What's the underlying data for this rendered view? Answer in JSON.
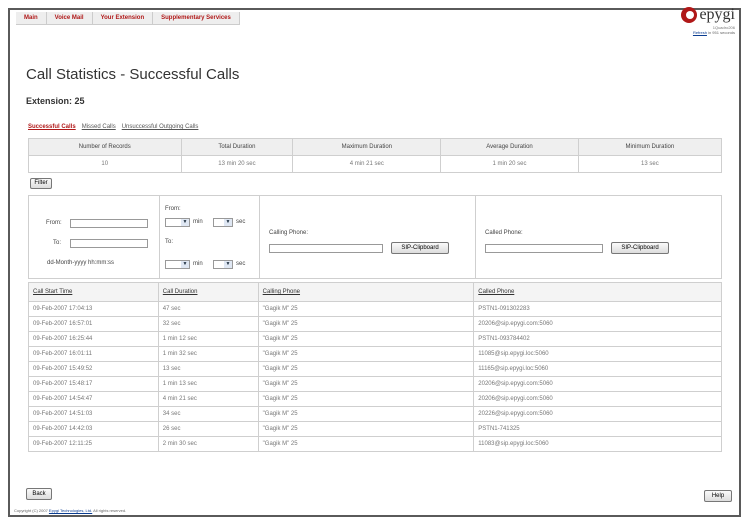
{
  "nav": {
    "items": [
      "Main",
      "Voice Mail",
      "Your Extension",
      "Supplementary Services"
    ]
  },
  "logo": {
    "brand": "epygi",
    "model": "1Quadro206",
    "refresh_link": "Refresh",
    "refresh_text": "in 951 seconds"
  },
  "page": {
    "title": "Call Statistics - Successful Calls",
    "extension": "Extension: 25"
  },
  "tabs": [
    {
      "label": "Successful Calls",
      "active": true
    },
    {
      "label": "Missed Calls",
      "active": false
    },
    {
      "label": "Unsuccessful Outgoing Calls",
      "active": false
    }
  ],
  "summary": {
    "headers": [
      "Number of Records",
      "Total Duration",
      "Maximum Duration",
      "Average Duration",
      "Minimum Duration"
    ],
    "values": [
      "10",
      "13 min 20 sec",
      "4 min 21 sec",
      "1 min 20 sec",
      "13 sec"
    ]
  },
  "filter": {
    "button": "Filter",
    "from_label": "From:",
    "to_label": "To:",
    "date_format": "dd-Month-yyyy hh:mm:ss",
    "duration_from": "From:",
    "duration_to": "To:",
    "min_label": "min",
    "sec_label": "sec",
    "calling_label": "Calling Phone:",
    "called_label": "Called Phone:",
    "sip_clipboard": "SIP-Clipboard"
  },
  "calls": {
    "headers": [
      "Call Start Time",
      "Call Duration",
      "Calling Phone",
      "Called Phone"
    ],
    "rows": [
      [
        "09-Feb-2007 17:04:13",
        "47 sec",
        "\"Gagik M\" 25",
        "PSTN1-091302283"
      ],
      [
        "09-Feb-2007 16:57:01",
        "32 sec",
        "\"Gagik M\" 25",
        "20206@sip.epygi.com:5060"
      ],
      [
        "09-Feb-2007 16:25:44",
        "1 min 12 sec",
        "\"Gagik M\" 25",
        "PSTN1-093784402"
      ],
      [
        "09-Feb-2007 16:01:11",
        "1 min 32 sec",
        "\"Gagik M\" 25",
        "11085@sip.epygi.loc:5060"
      ],
      [
        "09-Feb-2007 15:49:52",
        "13 sec",
        "\"Gagik M\" 25",
        "11165@sip.epygi.loc:5060"
      ],
      [
        "09-Feb-2007 15:48:17",
        "1 min 13 sec",
        "\"Gagik M\" 25",
        "20206@sip.epygi.com:5060"
      ],
      [
        "09-Feb-2007 14:54:47",
        "4 min 21 sec",
        "\"Gagik M\" 25",
        "20206@sip.epygi.com:5060"
      ],
      [
        "09-Feb-2007 14:51:03",
        "34 sec",
        "\"Gagik M\" 25",
        "20226@sip.epygi.com:5060"
      ],
      [
        "09-Feb-2007 14:42:03",
        "26 sec",
        "\"Gagik M\" 25",
        "PSTN1-741325"
      ],
      [
        "09-Feb-2007 12:11:25",
        "2 min 30 sec",
        "\"Gagik M\" 25",
        "11083@sip.epygi.loc:5060"
      ]
    ]
  },
  "buttons": {
    "back": "Back",
    "help": "Help"
  },
  "footer": {
    "prefix": "Copyright (C) 2007",
    "company": "Epygi Technologies, Ltd.",
    "suffix": "All rights reserved."
  },
  "colors": {
    "accent": "#b01818",
    "border": "#cfcfcf",
    "header_bg": "#efefef"
  }
}
